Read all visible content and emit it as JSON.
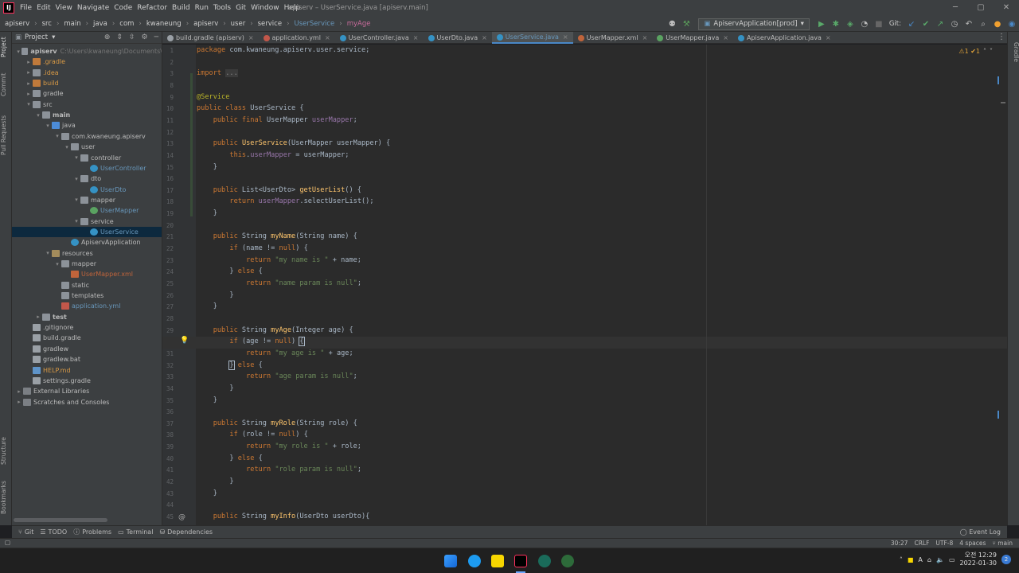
{
  "app": {
    "title": "apiserv – UserService.java [apiserv.main]",
    "menu": [
      "File",
      "Edit",
      "View",
      "Navigate",
      "Code",
      "Refactor",
      "Build",
      "Run",
      "Tools",
      "Git",
      "Window",
      "Help"
    ]
  },
  "breadcrumb": [
    "apiserv",
    "src",
    "main",
    "java",
    "com",
    "kwaneung",
    "apiserv",
    "user",
    "service",
    "UserService",
    "myAge"
  ],
  "toolbar": {
    "run_config": "ApiservApplication[prod]",
    "git_label": "Git:"
  },
  "project": {
    "header": "Project",
    "tree": [
      {
        "label": "apiserv",
        "extra": "C:\\Users\\kwaneung\\Documents\\",
        "indent": 0,
        "arrow": "▾",
        "icon": "folder",
        "cls": "mod"
      },
      {
        "label": ".gradle",
        "indent": 1,
        "arrow": "▸",
        "icon": "folder-ex",
        "cls": "ignored"
      },
      {
        "label": ".idea",
        "indent": 1,
        "arrow": "▸",
        "icon": "folder",
        "cls": "ignored"
      },
      {
        "label": "build",
        "indent": 1,
        "arrow": "▸",
        "icon": "folder-ex",
        "cls": "ignored"
      },
      {
        "label": "gradle",
        "indent": 1,
        "arrow": "▸",
        "icon": "folder",
        "cls": ""
      },
      {
        "label": "src",
        "indent": 1,
        "arrow": "▾",
        "icon": "folder",
        "cls": ""
      },
      {
        "label": "main",
        "indent": 2,
        "arrow": "▾",
        "icon": "folder",
        "cls": "mod"
      },
      {
        "label": "java",
        "indent": 3,
        "arrow": "▾",
        "icon": "folder-src",
        "cls": ""
      },
      {
        "label": "com.kwaneung.apiserv",
        "indent": 4,
        "arrow": "▾",
        "icon": "folder",
        "cls": ""
      },
      {
        "label": "user",
        "indent": 5,
        "arrow": "▾",
        "icon": "folder",
        "cls": ""
      },
      {
        "label": "controller",
        "indent": 6,
        "arrow": "▾",
        "icon": "folder",
        "cls": ""
      },
      {
        "label": "UserController",
        "indent": 7,
        "arrow": "",
        "icon": "class",
        "cls": "blue"
      },
      {
        "label": "dto",
        "indent": 6,
        "arrow": "▾",
        "icon": "folder",
        "cls": ""
      },
      {
        "label": "UserDto",
        "indent": 7,
        "arrow": "",
        "icon": "class",
        "cls": "blue"
      },
      {
        "label": "mapper",
        "indent": 6,
        "arrow": "▾",
        "icon": "folder",
        "cls": ""
      },
      {
        "label": "UserMapper",
        "indent": 7,
        "arrow": "",
        "icon": "iface",
        "cls": "blue"
      },
      {
        "label": "service",
        "indent": 6,
        "arrow": "▾",
        "icon": "folder",
        "cls": ""
      },
      {
        "label": "UserService",
        "indent": 7,
        "arrow": "",
        "icon": "class",
        "cls": "blue",
        "selected": true
      },
      {
        "label": "ApiservApplication",
        "indent": 5,
        "arrow": "",
        "icon": "app",
        "cls": ""
      },
      {
        "label": "resources",
        "indent": 3,
        "arrow": "▾",
        "icon": "folder-res",
        "cls": ""
      },
      {
        "label": "mapper",
        "indent": 4,
        "arrow": "▾",
        "icon": "folder",
        "cls": ""
      },
      {
        "label": "UserMapper.xml",
        "indent": 5,
        "arrow": "",
        "icon": "xml",
        "cls": "red"
      },
      {
        "label": "static",
        "indent": 4,
        "arrow": "",
        "icon": "folder",
        "cls": ""
      },
      {
        "label": "templates",
        "indent": 4,
        "arrow": "",
        "icon": "folder",
        "cls": ""
      },
      {
        "label": "application.yml",
        "indent": 4,
        "arrow": "",
        "icon": "yml",
        "cls": "blue"
      },
      {
        "label": "test",
        "indent": 2,
        "arrow": "▸",
        "icon": "folder",
        "cls": "mod"
      },
      {
        "label": ".gitignore",
        "indent": 1,
        "arrow": "",
        "icon": "file",
        "cls": ""
      },
      {
        "label": "build.gradle",
        "indent": 1,
        "arrow": "",
        "icon": "file",
        "cls": ""
      },
      {
        "label": "gradlew",
        "indent": 1,
        "arrow": "",
        "icon": "file",
        "cls": ""
      },
      {
        "label": "gradlew.bat",
        "indent": 1,
        "arrow": "",
        "icon": "file",
        "cls": ""
      },
      {
        "label": "HELP.md",
        "indent": 1,
        "arrow": "",
        "icon": "md",
        "cls": "ignored"
      },
      {
        "label": "settings.gradle",
        "indent": 1,
        "arrow": "",
        "icon": "file",
        "cls": ""
      },
      {
        "label": "External Libraries",
        "indent": 0,
        "arrow": "▸",
        "icon": "lib",
        "cls": ""
      },
      {
        "label": "Scratches and Consoles",
        "indent": 0,
        "arrow": "▸",
        "icon": "lib",
        "cls": ""
      }
    ]
  },
  "tabs": [
    {
      "label": "build.gradle (apiserv)",
      "color": "#9aa0a6",
      "active": false
    },
    {
      "label": "application.yml",
      "color": "#c2574a",
      "active": false
    },
    {
      "label": "UserController.java",
      "color": "#3592c4",
      "active": false
    },
    {
      "label": "UserDto.java",
      "color": "#3592c4",
      "active": false
    },
    {
      "label": "UserService.java",
      "color": "#3592c4",
      "active": true
    },
    {
      "label": "UserMapper.xml",
      "color": "#c0643b",
      "active": false
    },
    {
      "label": "UserMapper.java",
      "color": "#5aa361",
      "active": false
    },
    {
      "label": "ApiservApplication.java",
      "color": "#3592c4",
      "active": false
    }
  ],
  "editor": {
    "inspections": "⚠1 ✔1",
    "current_line": 30,
    "lines": [
      {
        "n": 1,
        "h": "<span class='kw'>package</span> com.kwaneung.apiserv.user.service;"
      },
      {
        "n": 2,
        "h": ""
      },
      {
        "n": 3,
        "h": "<span class='kw'>import</span> <span class='fold'>...</span>"
      },
      {
        "n": 8,
        "h": ""
      },
      {
        "n": 9,
        "h": "<span class='ann'>@Service</span>"
      },
      {
        "n": 10,
        "h": "<span class='kw'>public class</span> UserService {"
      },
      {
        "n": 11,
        "h": "    <span class='kw'>public final</span> UserMapper <span class='fld'>userMapper</span>;"
      },
      {
        "n": 12,
        "h": ""
      },
      {
        "n": 13,
        "h": "    <span class='kw'>public</span> <span class='fn'>UserService</span>(UserMapper userMapper) {"
      },
      {
        "n": 14,
        "h": "        <span class='kw'>this</span>.<span class='fld'>userMapper</span> = userMapper;"
      },
      {
        "n": 15,
        "h": "    }"
      },
      {
        "n": 16,
        "h": ""
      },
      {
        "n": 17,
        "h": "    <span class='kw'>public</span> List&lt;UserDto&gt; <span class='fn'>getUserList</span>() {"
      },
      {
        "n": 18,
        "h": "        <span class='kw'>return</span> <span class='fld'>userMapper</span>.selectUserList();"
      },
      {
        "n": 19,
        "h": "    }"
      },
      {
        "n": 20,
        "h": ""
      },
      {
        "n": 21,
        "h": "    <span class='kw'>public</span> String <span class='fn'>myName</span>(String name) {"
      },
      {
        "n": 22,
        "h": "        <span class='kw'>if</span> (name != <span class='kw'>null</span>) {"
      },
      {
        "n": 23,
        "h": "            <span class='kw'>return</span> <span class='str'>\"my name is \"</span> + name;"
      },
      {
        "n": 24,
        "h": "        } <span class='kw'>else</span> {"
      },
      {
        "n": 25,
        "h": "            <span class='kw'>return</span> <span class='str'>\"name param is null\"</span>;"
      },
      {
        "n": 26,
        "h": "        }"
      },
      {
        "n": 27,
        "h": "    }"
      },
      {
        "n": 28,
        "h": ""
      },
      {
        "n": 29,
        "h": "    <span class='kw'>public</span> String <span class='fn'>myAge</span>(Integer age) {"
      },
      {
        "n": 30,
        "h": "        <span class='kw'>if</span> (age != <span class='kw'>null</span>) <span style='outline:1px solid #a9b7c6'>{</span>"
      },
      {
        "n": 31,
        "h": "            <span class='kw'>return</span> <span class='str'>\"my age is \"</span> + age;"
      },
      {
        "n": 32,
        "h": "        <span style='outline:1px solid #a9b7c6'>}</span> <span class='kw'>else</span> {"
      },
      {
        "n": 33,
        "h": "            <span class='kw'>return</span> <span class='str'>\"age param is null\"</span>;"
      },
      {
        "n": 34,
        "h": "        }"
      },
      {
        "n": 35,
        "h": "    }"
      },
      {
        "n": 36,
        "h": ""
      },
      {
        "n": 37,
        "h": "    <span class='kw'>public</span> String <span class='fn'>myRole</span>(String role) {"
      },
      {
        "n": 38,
        "h": "        <span class='kw'>if</span> (role != <span class='kw'>null</span>) {"
      },
      {
        "n": 39,
        "h": "            <span class='kw'>return</span> <span class='str'>\"my role is \"</span> + role;"
      },
      {
        "n": 40,
        "h": "        } <span class='kw'>else</span> {"
      },
      {
        "n": 41,
        "h": "            <span class='kw'>return</span> <span class='str'>\"role param is null\"</span>;"
      },
      {
        "n": 42,
        "h": "        }"
      },
      {
        "n": 43,
        "h": "    }"
      },
      {
        "n": 44,
        "h": ""
      },
      {
        "n": 45,
        "h": "    <span class='kw'>public</span> String <span class='fn'>myInfo</span>(UserDto userDto){"
      }
    ]
  },
  "left_tool_tabs": [
    "Project",
    "Commit",
    "Pull Requests",
    "Structure",
    "Bookmarks"
  ],
  "right_tool_tabs": [
    "Gradle"
  ],
  "bottom_tools": [
    "Git",
    "TODO",
    "Problems",
    "Terminal",
    "Dependencies"
  ],
  "event_log": "Event Log",
  "status": {
    "position": "30:27",
    "line_sep": "CRLF",
    "encoding": "UTF-8",
    "indent": "4 spaces",
    "branch": "main"
  },
  "taskbar": {
    "time": "오전 12:29",
    "date": "2022-01-30",
    "notifications": "2",
    "tray_lang": "A"
  }
}
